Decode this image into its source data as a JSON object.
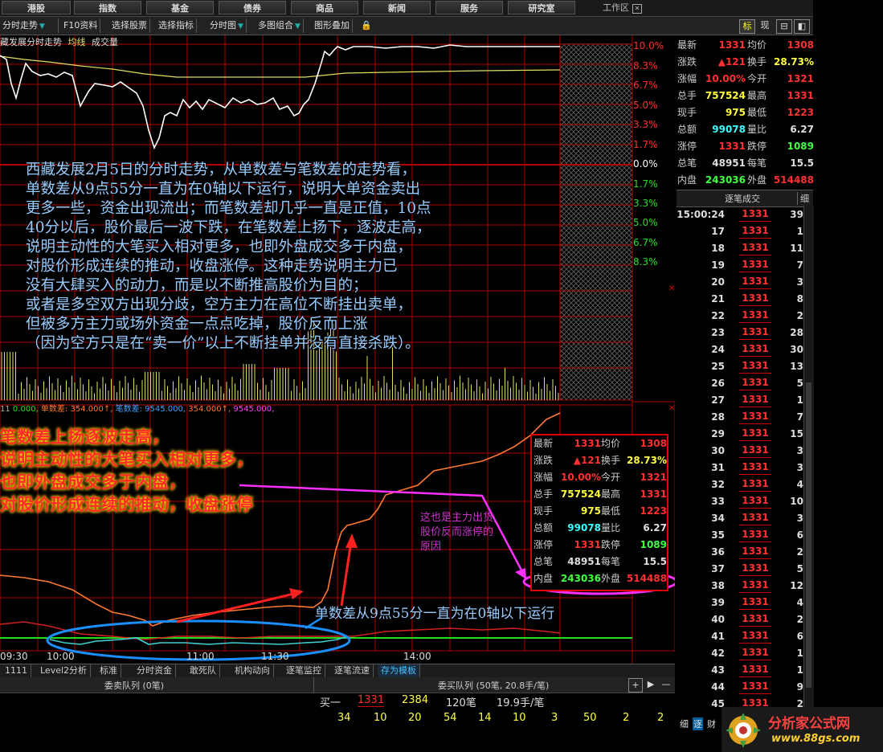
{
  "nav": {
    "buttons": [
      "港股",
      "指数",
      "基金",
      "债券",
      "商品",
      "新闻",
      "服务",
      "研究室"
    ],
    "workarea_label": "工作区"
  },
  "toolbar": {
    "items": [
      "分时走势",
      "F10资料",
      "选择股票",
      "选择指标",
      "分时图",
      "多图组合",
      "图形叠加"
    ]
  },
  "right_tabs": {
    "tab1": "标",
    "tab2": "现"
  },
  "price_chart": {
    "title": "藏发展分时走势",
    "avg_label": "均线",
    "vol_label": "成交量",
    "pct_labels_up": [
      "10.0%",
      "8.3%",
      "6.7%",
      "5.0%",
      "3.3%",
      "1.7%"
    ],
    "zero_label": "0.0%",
    "pct_labels_down": [
      "1.7%",
      "3.3%",
      "5.0%",
      "6.7%",
      "8.3%"
    ]
  },
  "indicator": {
    "prefix": "11",
    "v1": "0.000,",
    "label2": "单数差:",
    "v2": "354.000↑,",
    "label3": "笔数差:",
    "v3": "9545.000,",
    "v4": "354.000↑,",
    "v5": "9545.000,"
  },
  "time_axis": [
    "09:30",
    "10:00",
    "11:00",
    "11:30",
    "14:00"
  ],
  "quote": {
    "rows": [
      {
        "l1": "最新",
        "v1": "1331",
        "c1": "#ff3030",
        "l2": "均价",
        "v2": "1308",
        "c2": "#ff3030"
      },
      {
        "l1": "涨跌",
        "v1": "▲121",
        "c1": "#ff3030",
        "l2": "换手",
        "v2": "28.73%",
        "c2": "#ffff40"
      },
      {
        "l1": "涨幅",
        "v1": "10.00%",
        "c1": "#ff3030",
        "l2": "今开",
        "v2": "1321",
        "c2": "#ff3030"
      },
      {
        "l1": "总手",
        "v1": "757524",
        "c1": "#ffff40",
        "l2": "最高",
        "v2": "1331",
        "c2": "#ff3030"
      },
      {
        "l1": "现手",
        "v1": "975",
        "c1": "#ffff40",
        "l2": "最低",
        "v2": "1223",
        "c2": "#ff3030"
      },
      {
        "l1": "总额",
        "v1": "99078",
        "c1": "#40ffff",
        "l2": "量比",
        "v2": "6.27",
        "c2": "#dddddd"
      },
      {
        "l1": "涨停",
        "v1": "1331",
        "c1": "#ff3030",
        "l2": "跌停",
        "v2": "1089",
        "c2": "#40ff40"
      },
      {
        "l1": "总笔",
        "v1": "48951",
        "c1": "#dddddd",
        "l2": "每笔",
        "v2": "15.5",
        "c2": "#dddddd"
      },
      {
        "l1": "内盘",
        "v1": "243036",
        "c1": "#40ff40",
        "l2": "外盘",
        "v2": "514488",
        "c2": "#ff3030"
      }
    ]
  },
  "ticks": {
    "header": "逐笔成交",
    "header_right": "细",
    "rows": [
      {
        "t": "15:00:24",
        "p": "1331",
        "v": "39"
      },
      {
        "t": "17",
        "p": "1331",
        "v": "1"
      },
      {
        "t": "18",
        "p": "1331",
        "v": "11"
      },
      {
        "t": "19",
        "p": "1331",
        "v": "7"
      },
      {
        "t": "20",
        "p": "1331",
        "v": "3"
      },
      {
        "t": "21",
        "p": "1331",
        "v": "8"
      },
      {
        "t": "22",
        "p": "1331",
        "v": "2"
      },
      {
        "t": "23",
        "p": "1331",
        "v": "28"
      },
      {
        "t": "24",
        "p": "1331",
        "v": "30"
      },
      {
        "t": "25",
        "p": "1331",
        "v": "13"
      },
      {
        "t": "26",
        "p": "1331",
        "v": "5"
      },
      {
        "t": "27",
        "p": "1331",
        "v": "1"
      },
      {
        "t": "28",
        "p": "1331",
        "v": "7"
      },
      {
        "t": "29",
        "p": "1331",
        "v": "15"
      },
      {
        "t": "30",
        "p": "1331",
        "v": "3"
      },
      {
        "t": "31",
        "p": "1331",
        "v": "3"
      },
      {
        "t": "32",
        "p": "1331",
        "v": "4"
      },
      {
        "t": "33",
        "p": "1331",
        "v": "10"
      },
      {
        "t": "34",
        "p": "1331",
        "v": "3"
      },
      {
        "t": "35",
        "p": "1331",
        "v": "6"
      },
      {
        "t": "36",
        "p": "1331",
        "v": "2"
      },
      {
        "t": "37",
        "p": "1331",
        "v": "5"
      },
      {
        "t": "38",
        "p": "1331",
        "v": "12"
      },
      {
        "t": "39",
        "p": "1331",
        "v": "4"
      },
      {
        "t": "40",
        "p": "1331",
        "v": "2"
      },
      {
        "t": "41",
        "p": "1331",
        "v": "6"
      },
      {
        "t": "42",
        "p": "1331",
        "v": "1"
      },
      {
        "t": "43",
        "p": "1331",
        "v": "1"
      },
      {
        "t": "44",
        "p": "1331",
        "v": "9"
      },
      {
        "t": "45",
        "p": "1331",
        "v": "2"
      }
    ]
  },
  "annotations": {
    "main": "西藏发展2月5日的分时走势，从单数差与笔数差的走势看，\n单数差从9点55分一直为在0轴以下运行，说明大单资金卖出\n更多一些，资金出现流出；而笔数差却几乎一直是正值，10点\n40分以后，股价最后一波下跌，在笔数差上扬下，逐波走高，\n说明主动性的大笔买入相对更多，也即外盘成交多于内盘，\n对股价形成连续的推动，收盘涨停。这种走势说明主力已\n没有大肆买入的动力，而是以不断推高股价为目的；\n或者是多空双方出现分歧，空方主力在高位不断挂出卖单，\n但被多方主力或场外资金一点点吃掉，股价反而上涨\n（因为空方只是在“卖一价”以上不断挂单并没有直接杀跌）。",
    "red": "笔数差上扬逐波走高，\n说明主动性的大笔买入相对更多，\n也即外盘成交多于内盘，\n对股价形成连续的推动，收盘涨停",
    "purple": "这也是主力出货,\n股价反而涨停的\n原因",
    "blue": "单数差从9点55分一直为在0轴以下运行"
  },
  "bottom_tabs": [
    "1111",
    "Level2分析",
    "标准",
    "分时资金",
    "敢死队",
    "机构动向",
    "逐笔监控",
    "逐笔流速",
    "存为模板"
  ],
  "queue": {
    "left_title": "委卖队列 (0笔)",
    "right_title": "委买队列 (50笔, 20.8手/笔)",
    "row_label": "买一",
    "price": "1331",
    "vol": "2384",
    "count": "120笔",
    "avg": "19.9手/笔",
    "orders": [
      "34",
      "10",
      "20",
      "54",
      "14",
      "10",
      "3",
      "50",
      "2",
      "2"
    ]
  },
  "bottom_right": {
    "a": "细",
    "b": "逐",
    "c": "财"
  },
  "logo": {
    "name": "分析家公式网",
    "url": "www.88gs.com"
  },
  "colors": {
    "grid": "#b00000",
    "price": "#ffffff",
    "avg": "#e0e060",
    "volume": "#e0e060",
    "bishu": "#ff7a30",
    "danshu": "#40d0d0",
    "zero_green": "#20e020",
    "annot_red": "#ff2020",
    "ellipse_blue": "#1a8fff",
    "ellipse_magenta": "#ff30ff"
  }
}
